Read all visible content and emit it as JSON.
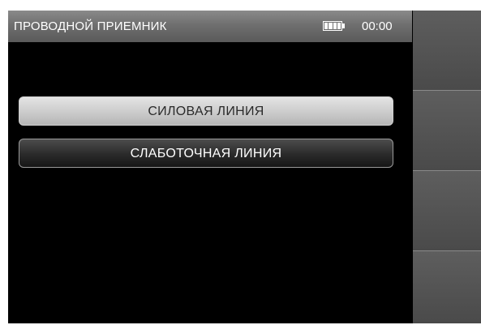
{
  "header": {
    "title": "ПРОВОДНОЙ ПРИЕМНИК",
    "battery_icon": "battery-full-icon",
    "time": "00:00"
  },
  "menu": {
    "items": [
      {
        "label": "СИЛОВАЯ ЛИНИЯ",
        "selected": true
      },
      {
        "label": "СЛАБОТОЧНАЯ ЛИНИЯ",
        "selected": false
      }
    ]
  },
  "softkeys": [
    {
      "label": ""
    },
    {
      "label": ""
    },
    {
      "label": ""
    },
    {
      "label": ""
    }
  ],
  "colors": {
    "background": "#000000",
    "header": "#6f6f6f",
    "selected_button": "#c9c9c9",
    "normal_button": "#2a2a2a",
    "softkey": "#4a4a4a"
  }
}
